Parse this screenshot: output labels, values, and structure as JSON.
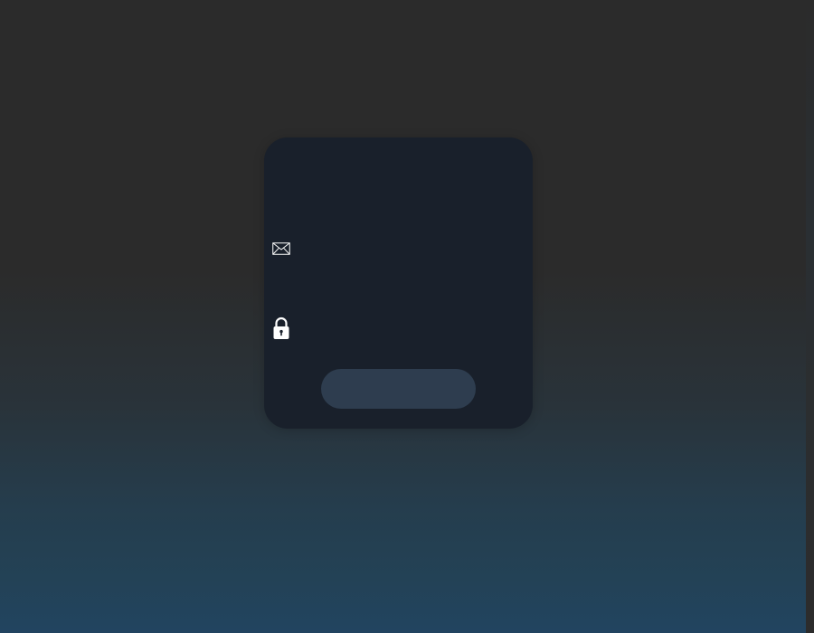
{
  "login_form": {
    "email": {
      "icon": "mail-icon",
      "value": "",
      "placeholder": ""
    },
    "password": {
      "icon": "lock-icon",
      "value": "",
      "placeholder": ""
    },
    "submit_label": ""
  },
  "colors": {
    "card_background": "#19202b",
    "button_background": "#2e3d4f",
    "page_top": "#2b2b2b",
    "page_bottom": "#224460"
  }
}
